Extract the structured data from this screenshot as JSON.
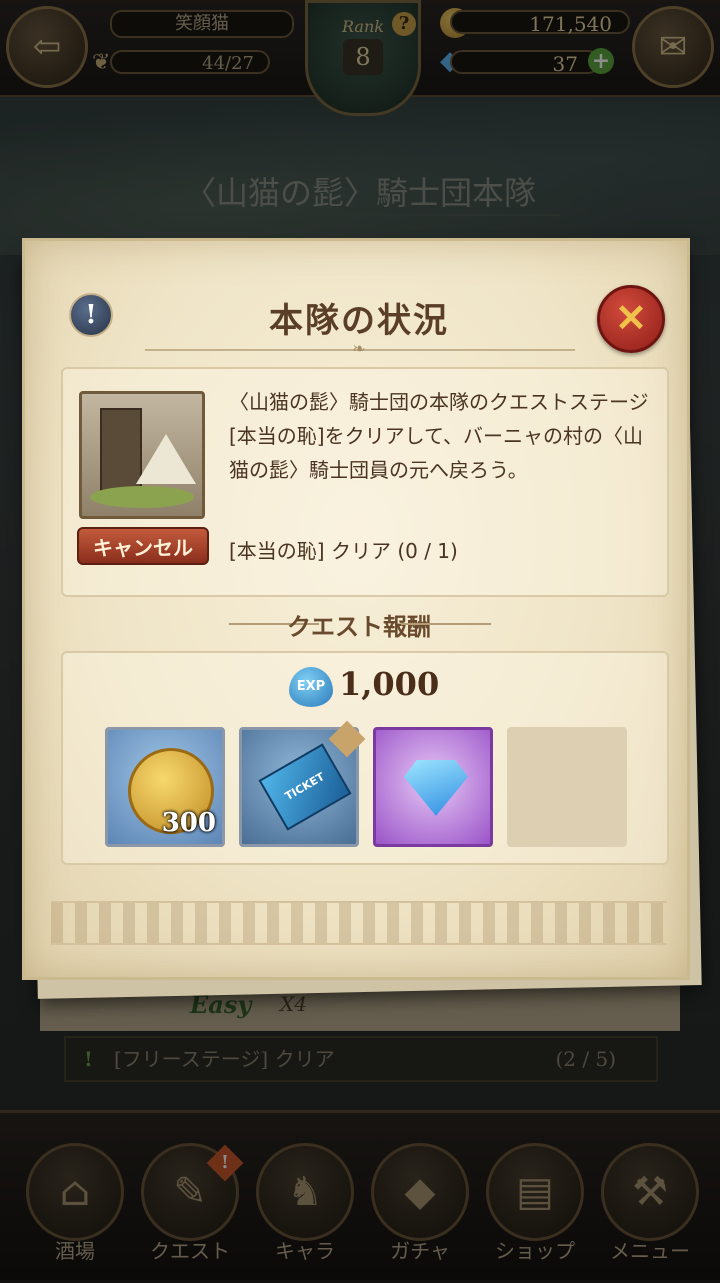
{
  "header": {
    "player_name": "笑顔猫",
    "stamina": "44/27",
    "rank_label": "Rank",
    "rank_value": "8",
    "rank_help": "?",
    "gold": "171,540",
    "gems": "37",
    "add_gem": "+"
  },
  "background": {
    "title": "〈山猫の髭〉騎士団本隊",
    "difficulty": "Easy",
    "multiplier": "X4",
    "condition_text": "[フリーステージ] クリア",
    "condition_count": "(2 / 5)",
    "condition_alert": "!"
  },
  "nav": {
    "items": [
      {
        "label": "酒場"
      },
      {
        "label": "クエスト"
      },
      {
        "label": "キャラ"
      },
      {
        "label": "ガチャ"
      },
      {
        "label": "ショップ"
      },
      {
        "label": "メニュー"
      }
    ],
    "alert": "!"
  },
  "modal": {
    "info": "!",
    "title": "本隊の状況",
    "close": "✕",
    "cancel_label": "キャンセル",
    "description": "〈山猫の髭〉騎士団の本隊のクエストステージ[本当の恥]をクリアして、バーニャの村の〈山猫の髭〉騎士団員の元へ戻ろう。",
    "condition": "[本当の恥] クリア (0 / 1)",
    "reward_header": "クエスト報酬",
    "exp_icon": "EXP",
    "exp_value": "1,000",
    "rewards": {
      "coin_qty": "300",
      "ticket_label": "TICKET"
    }
  },
  "icons": {
    "back": "back-arrow-icon",
    "mail": "mail-icon",
    "coin": "coin-icon",
    "gem": "gem-icon"
  },
  "colors": {
    "parchment": "#efe4c6",
    "title_brown": "#5a3e28",
    "close_red": "#b33226"
  }
}
